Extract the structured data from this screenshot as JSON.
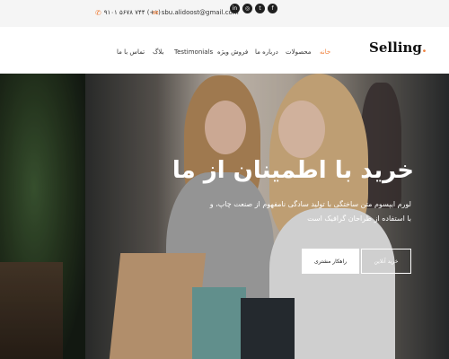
{
  "topbar": {
    "phone": "۹۱۰۱ ۵۶۷۸ ۷۴۴ (+۱)",
    "phone_icon": "phone-icon",
    "email": "sbu.alidoost@gmail.com",
    "email_icon": "envelope-icon",
    "social": [
      {
        "icon": "facebook-icon",
        "glyph": "f"
      },
      {
        "icon": "twitter-icon",
        "glyph": "t"
      },
      {
        "icon": "instagram-icon",
        "glyph": "◎"
      },
      {
        "icon": "linkedin-icon",
        "glyph": "in"
      }
    ]
  },
  "brand": {
    "name": "Selling",
    "dot": "."
  },
  "nav": {
    "items": [
      "خانه",
      "محصولات",
      "درباره ما",
      "فروش ویژه",
      "Testimonials",
      "بلاگ",
      "تماس با ما"
    ],
    "active_index": 0
  },
  "hero": {
    "title": "خرید با اطمینان از ما",
    "description": "لورم ایپسوم متن ساختگی با تولید سادگی نامفهوم از صنعت چاپ، و با استفاده از طراحان گرافیک است",
    "primary_button": "راهکار مشتری",
    "secondary_button": "خرید آنلاین"
  },
  "colors": {
    "accent": "#f0803c",
    "topbar_bg": "#f5f5f5",
    "text_dark": "#333333"
  }
}
